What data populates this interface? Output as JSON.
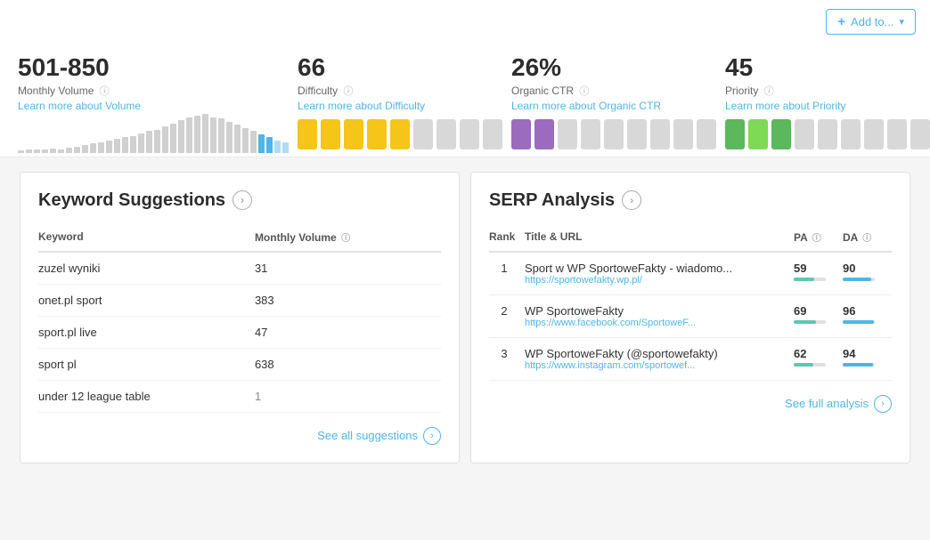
{
  "toolbar": {
    "add_to_label": "Add to...",
    "plus_symbol": "+"
  },
  "metrics": {
    "volume": {
      "value": "501-850",
      "label": "Monthly Volume",
      "link_text": "Learn more about Volume",
      "bars": [
        3,
        4,
        4,
        5,
        6,
        5,
        7,
        8,
        10,
        12,
        14,
        16,
        18,
        20,
        22,
        25,
        28,
        30,
        34,
        38,
        42,
        45,
        48,
        50,
        46,
        44,
        40,
        36,
        32,
        28,
        24,
        20,
        16,
        14
      ]
    },
    "difficulty": {
      "value": "66",
      "label": "Difficulty",
      "link_text": "Learn more about Difficulty",
      "filled": 5,
      "total": 9
    },
    "organic_ctr": {
      "value": "26%",
      "label": "Organic CTR",
      "link_text": "Learn more about Organic CTR",
      "filled": 2,
      "total": 9
    },
    "priority": {
      "value": "45",
      "label": "Priority",
      "link_text": "Learn more about Priority",
      "filled": 3,
      "total": 9
    }
  },
  "keyword_suggestions": {
    "title": "Keyword Suggestions",
    "column_keyword": "Keyword",
    "column_volume": "Monthly Volume",
    "rows": [
      {
        "keyword": "zuzel wyniki",
        "volume": "31"
      },
      {
        "keyword": "onet.pl sport",
        "volume": "383"
      },
      {
        "keyword": "sport.pl live",
        "volume": "47"
      },
      {
        "keyword": "sport pl",
        "volume": "638"
      },
      {
        "keyword": "under 12 league table",
        "volume": "1"
      }
    ],
    "see_all_label": "See all suggestions"
  },
  "serp_analysis": {
    "title": "SERP Analysis",
    "col_rank": "Rank",
    "col_title_url": "Title & URL",
    "col_pa": "PA",
    "col_da": "DA",
    "rows": [
      {
        "rank": "1",
        "title": "Sport w WP SportoweFakty - wiadomo...",
        "url": "https://sportowefakty.wp.pl/",
        "pa": "59",
        "pa_pct": 65,
        "da": "90",
        "da_pct": 90
      },
      {
        "rank": "2",
        "title": "WP SportoweFakty",
        "url": "https://www.facebook.com/SportoweF...",
        "pa": "69",
        "pa_pct": 69,
        "da": "96",
        "da_pct": 96
      },
      {
        "rank": "3",
        "title": "WP SportoweFakty (@sportowefakty)",
        "url": "https://www.instagram.com/sportowef...",
        "pa": "62",
        "pa_pct": 62,
        "da": "94",
        "da_pct": 94
      }
    ],
    "see_full_label": "See full analysis"
  }
}
